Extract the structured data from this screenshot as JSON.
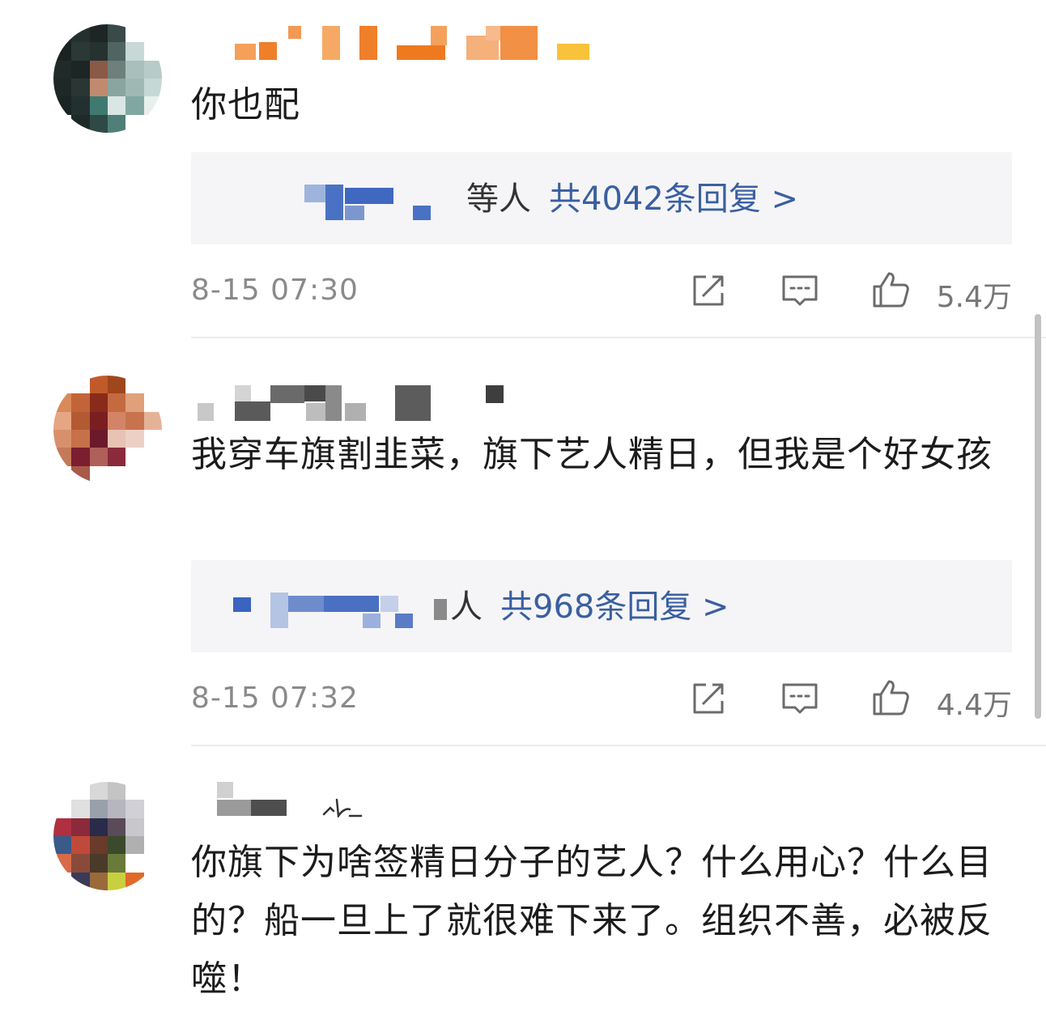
{
  "comments": [
    {
      "text": "你也配",
      "reply_suffix": "等人",
      "reply_link": "共4042条回复 >",
      "timestamp": "8-15 07:30",
      "likes": "5.4万"
    },
    {
      "text": "我穿车旗割韭菜，旗下艺人精日，但我是个好女孩",
      "reply_suffix": "人",
      "reply_link": "共968条回复 >",
      "timestamp": "8-15 07:32",
      "likes": "4.4万"
    },
    {
      "text": "你旗下为啥签精日分子的艺人？什么用心？什么目的？船一旦上了就很难下来了。组织不善，必被反噬！"
    }
  ],
  "icons": {
    "share": "share-icon",
    "comment": "comment-icon",
    "like": "thumbs-up-icon"
  },
  "colors": {
    "link": "#3a5fa0",
    "timestamp": "#8a8a8a",
    "reply_box": "#f5f5f7"
  }
}
